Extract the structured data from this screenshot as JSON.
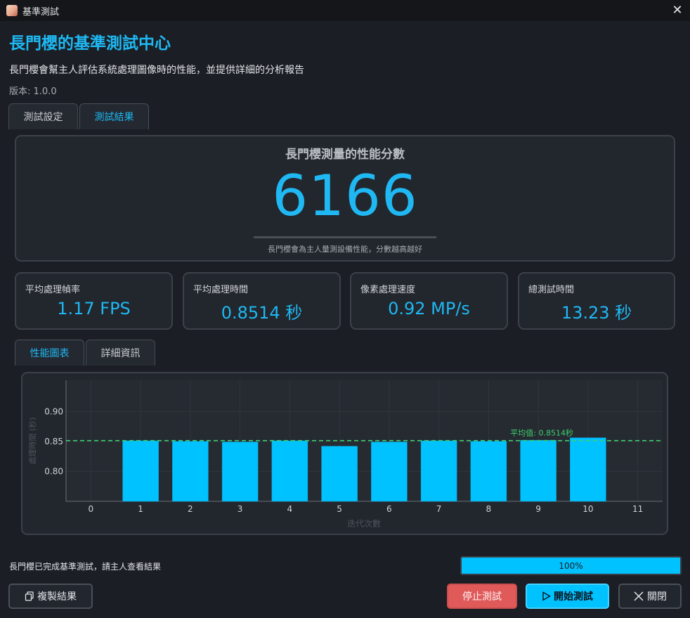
{
  "window": {
    "title": "基準測試",
    "close_glyph": "✕"
  },
  "header": {
    "title": "長門櫻的基準測試中心",
    "subtitle": "長門櫻會幫主人評估系統處理圖像時的性能，並提供詳細的分析報告",
    "version": "版本: 1.0.0"
  },
  "main_tabs": [
    {
      "label": "測試設定",
      "active": false
    },
    {
      "label": "測試結果",
      "active": true
    }
  ],
  "score": {
    "title": "長門櫻測量的性能分數",
    "value": "6166",
    "note": "長門櫻會為主人量測設備性能，分數越高越好"
  },
  "stats": [
    {
      "label": "平均處理幀率",
      "value": "1.17 FPS"
    },
    {
      "label": "平均處理時間",
      "value": "0.8514 秒"
    },
    {
      "label": "像素處理速度",
      "value": "0.92 MP/s"
    },
    {
      "label": "總測試時間",
      "value": "13.23 秒"
    }
  ],
  "sub_tabs": [
    {
      "label": "性能圖表",
      "active": true
    },
    {
      "label": "詳細資訊",
      "active": false
    }
  ],
  "chart_data": {
    "type": "bar",
    "xlabel": "迭代次數",
    "ylabel": "處理時間 (秒)",
    "x_ticks": [
      "0",
      "1",
      "2",
      "3",
      "4",
      "5",
      "6",
      "7",
      "8",
      "9",
      "10",
      "11"
    ],
    "y_ticks": [
      "0.80",
      "0.85",
      "0.90"
    ],
    "xlim": [
      -0.5,
      11.5
    ],
    "ylim": [
      0.75,
      0.952
    ],
    "x": [
      1,
      2,
      3,
      4,
      5,
      6,
      7,
      8,
      9,
      10
    ],
    "values": [
      0.851,
      0.85,
      0.849,
      0.851,
      0.842,
      0.849,
      0.851,
      0.85,
      0.852,
      0.856
    ],
    "average": 0.8514,
    "average_label": "平均值: 0.8514秒",
    "bar_color": "#00c2ff",
    "average_color": "#3ecf6e",
    "grid": true
  },
  "status": {
    "message": "長門櫻已完成基準測試，請主人查看結果"
  },
  "progress": {
    "value": 1.0,
    "label": "100%"
  },
  "buttons": {
    "copy": "複製結果",
    "stop": "停止測試",
    "start": "開始測試",
    "close": "關閉"
  },
  "colors": {
    "accent": "#1fb8f2",
    "background": "#1b1e24",
    "danger": "#e05a5a"
  }
}
